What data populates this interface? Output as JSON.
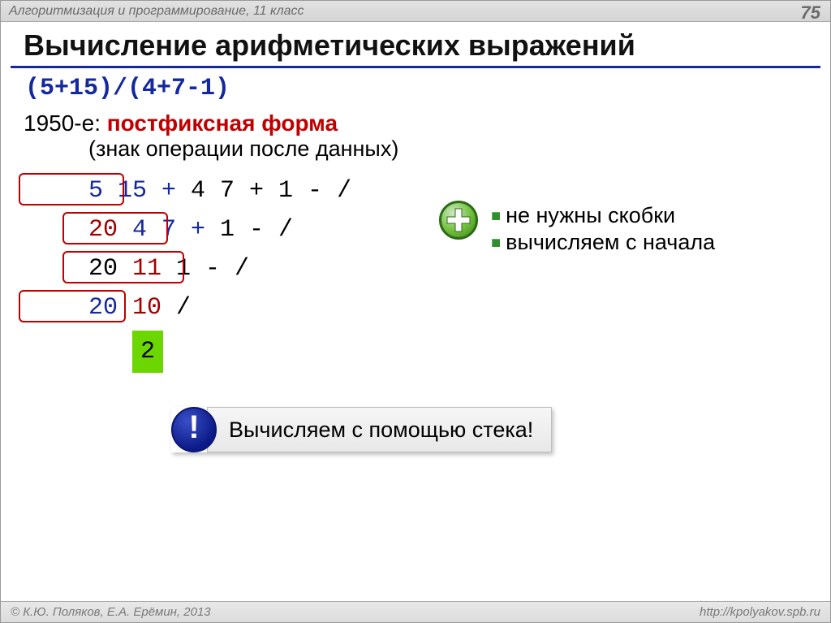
{
  "header": {
    "breadcrumb": "Алгоритмизация и программирование, 11 класс",
    "page_number": "75"
  },
  "title": "Вычисление арифметических выражений",
  "expression_infix": "(5+15)/(4+7-1)",
  "intro": {
    "year": "1950-е",
    "colon_space": ": ",
    "term": "постфиксная форма",
    "sub": "(знак операции после данных)"
  },
  "steps": {
    "row1": {
      "blue": "5 15 +",
      "rest": " 4 7 + 1 - /"
    },
    "row2": {
      "red": "20",
      "blue": " 4 7 +",
      "rest": " 1 - /"
    },
    "row3": {
      "lead": "20 ",
      "red": "11",
      "rest": " 1 - /"
    },
    "row4": {
      "blue": "20 ",
      "red": "10",
      "rest": " /"
    },
    "result": "2"
  },
  "benefits": {
    "item1": "не нужны скобки",
    "item2": "вычисляем с начала"
  },
  "callout": {
    "mark": "!",
    "text": "Вычисляем с помощью стека!"
  },
  "footer": {
    "left": "© К.Ю. Поляков, Е.А. Ерёмин, 2013",
    "right": "http://kpolyakov.spb.ru"
  }
}
